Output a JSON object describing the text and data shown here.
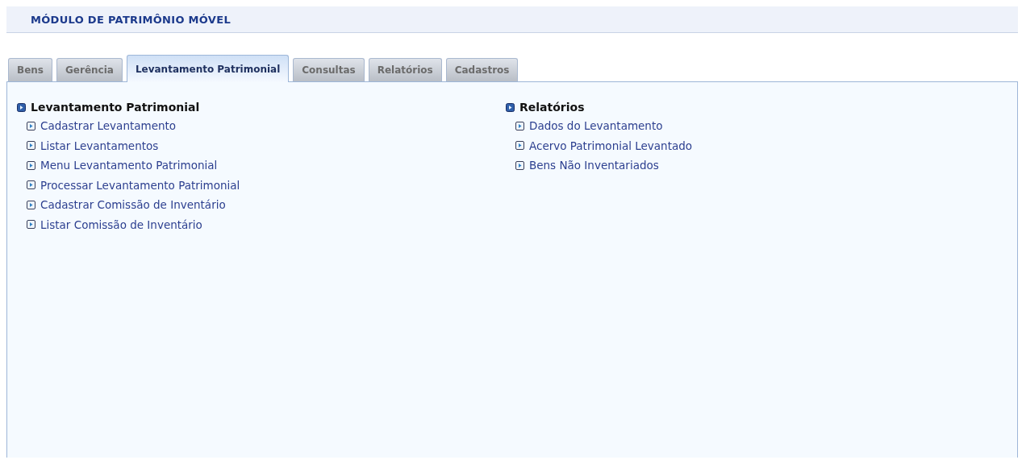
{
  "title": "MÓDULO DE PATRIMÔNIO MÓVEL",
  "tabs": [
    {
      "label": "Bens",
      "selected": false
    },
    {
      "label": "Gerência",
      "selected": false
    },
    {
      "label": "Levantamento Patrimonial",
      "selected": true
    },
    {
      "label": "Consultas",
      "selected": false
    },
    {
      "label": "Relatórios",
      "selected": false
    },
    {
      "label": "Cadastros",
      "selected": false
    }
  ],
  "sections": [
    {
      "heading": "Levantamento Patrimonial",
      "items": [
        "Cadastrar Levantamento",
        "Listar Levantamentos",
        "Menu Levantamento Patrimonial",
        "Processar Levantamento Patrimonial",
        "Cadastrar Comissão de Inventário",
        "Listar Comissão de Inventário"
      ]
    },
    {
      "heading": "Relatórios",
      "items": [
        "Dados do Levantamento",
        "Acervo Patrimonial Levantado",
        "Bens Não Inventariados"
      ]
    }
  ]
}
